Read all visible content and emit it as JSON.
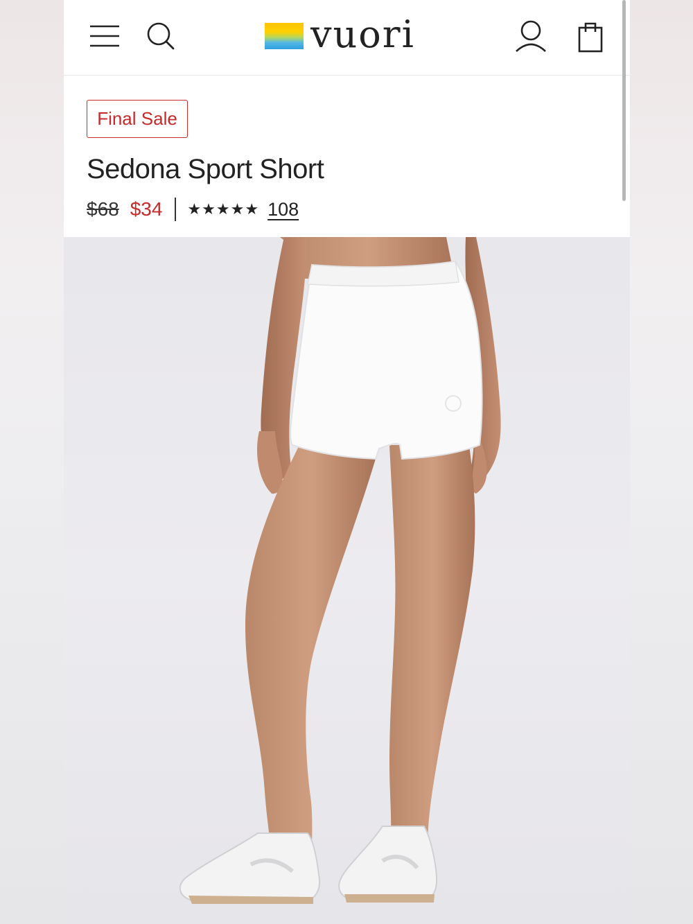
{
  "header": {
    "logo_text": "vuori",
    "icons": [
      "menu-icon",
      "search-icon",
      "account-icon",
      "shopping-bag-icon"
    ]
  },
  "product": {
    "badge": "Final Sale",
    "name": "Sedona Sport Short",
    "original_price": "$68",
    "sale_price": "$34",
    "rating_stars": "★★★★★",
    "rating_value": 5,
    "review_count": "108"
  },
  "hero_image": {
    "description": "model wearing white shorts and white sneakers"
  },
  "colors": {
    "sale_red": "#c62a2a",
    "text_dark": "#222222"
  }
}
